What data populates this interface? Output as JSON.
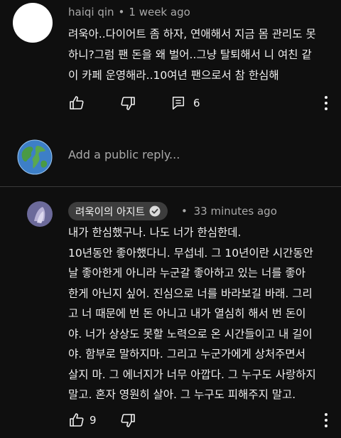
{
  "comment": {
    "author": "haiqi qin",
    "separator": "•",
    "time": "1 week ago",
    "lines": [
      "려욱아..다이어트 좀 하자, 연애해서 지금 몸 관리도 못",
      "하니?그럼 팬 돈을 왜 벌어..그냥 탈퇴해서 니 여친 같",
      "이 카페 운영해라..10여년 팬으로서 참 한심해"
    ],
    "reply_count": "6"
  },
  "reply_box": {
    "placeholder": "Add a public reply..."
  },
  "reply": {
    "author": "려욱이의 아지트",
    "separator": "•",
    "time": "33 minutes ago",
    "lines": [
      "내가 한심했구나. 나도 너가 한심한데.",
      "10년동안 좋아했다니. 무섭네. 그 10년이란 시간동안",
      "날 좋아한게 아니라 누군갈 좋아하고 있는 너를 좋아",
      "한게 아닌지 싶어. 진심으로 너를 바라보길 바래. 그리",
      "고 너 때문에 번 돈 아니고 내가 열심히 해서 번 돈이",
      "야. 너가 상상도 못할 노력으로 온 시간들이고 내 길이",
      "야. 함부로 말하지마. 그리고 누군가에게 상처주면서",
      "살지 마. 그 에너지가 너무 아깝다. 그 누구도 사랑하지",
      "말고. 혼자 영원히 살아. 그 누구도 피해주지 말고."
    ],
    "like_count": "9"
  },
  "icons": {
    "like": "thumbs-up-icon",
    "dislike": "thumbs-down-icon",
    "reply": "comment-icon",
    "more": "more-vertical-icon",
    "verified": "check-circle-icon",
    "globe": "globe-icon"
  }
}
